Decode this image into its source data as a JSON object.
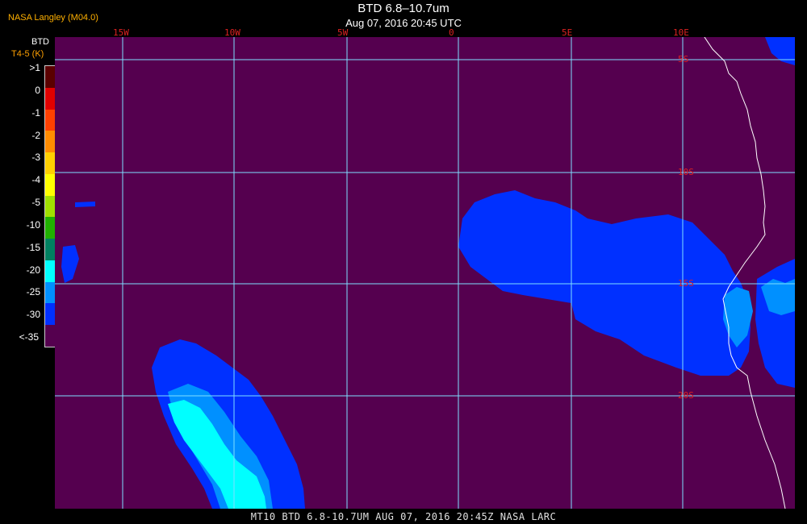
{
  "header": {
    "credit": "NASA Langley (M04.0)",
    "title": "BTD 6.8–10.7um",
    "subtitle": "Aug 07, 2016 20:45 UTC"
  },
  "legend": {
    "title": "BTD",
    "unit": "T4-5 (K)",
    "ticks": [
      ">1",
      "0",
      "-1",
      "-2",
      "-3",
      "-4",
      "-5",
      "-10",
      "-15",
      "-20",
      "-25",
      "-30",
      "<-35"
    ],
    "colors": [
      "#5a0000",
      "#e00000",
      "#ff4000",
      "#ff8c00",
      "#ffd000",
      "#ffff00",
      "#a0e000",
      "#20b000",
      "#008060",
      "#00ffff",
      "#0090ff",
      "#0030ff",
      "#55004f"
    ]
  },
  "map": {
    "background_color": "#55004f",
    "grid_color": "#7fdfff",
    "coast_color": "#ffffff",
    "lon_labels": [
      "15W",
      "10W",
      "5W",
      "0",
      "5E",
      "10E"
    ],
    "lat_labels": [
      "5S",
      "10S",
      "15S",
      "20S"
    ]
  },
  "footer": {
    "text": "MT10  BTD 6.8-10.7UM   AUG 07, 2016 20:45Z   NASA LARC"
  }
}
